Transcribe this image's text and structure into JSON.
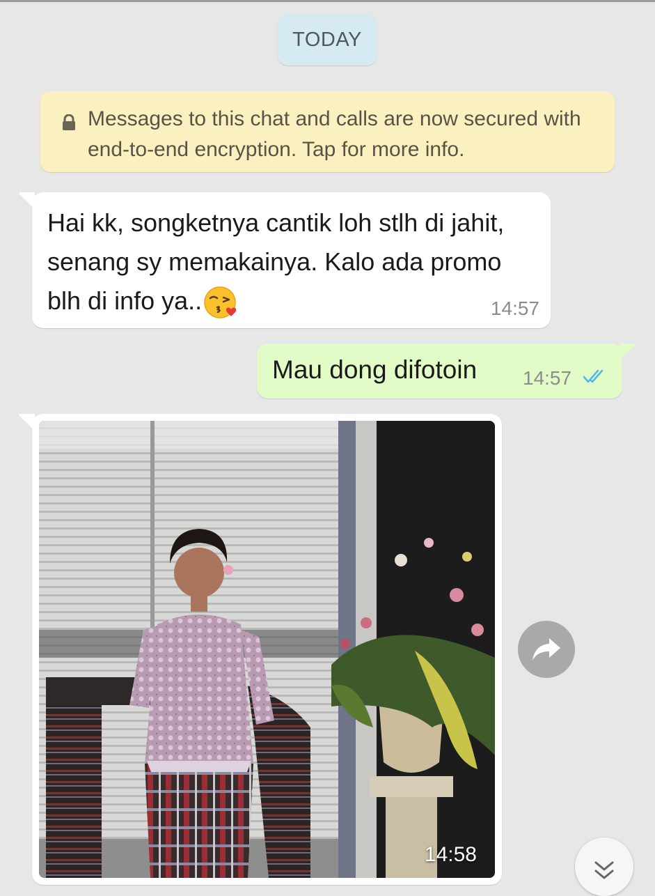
{
  "chat": {
    "date_label": "TODAY",
    "encryption_notice": "Messages to this chat and calls are now secured with end-to-end encryption. Tap for more info.",
    "messages": [
      {
        "direction": "incoming",
        "text": "Hai kk, songketnya cantik loh stlh di jahit, senang sy memakainya. Kalo ada promo blh di info ya..",
        "emoji": "kissing-face-with-heart",
        "time": "14:57"
      },
      {
        "direction": "outgoing",
        "text": "Mau dong difotoin",
        "time": "14:57",
        "status": "read"
      },
      {
        "direction": "incoming",
        "type": "image",
        "image_description": "woman in lilac lace kebaya holding a dark striped songket beside a vase of flowers",
        "time": "14:58"
      }
    ]
  },
  "colors": {
    "background": "#e7e7e7",
    "incoming_bubble": "#ffffff",
    "outgoing_bubble": "#e2fcc7",
    "encryption_notice": "#fbf0bf",
    "date_chip": "#d6eaf2",
    "read_ticks": "#4fb5ea"
  },
  "icons": {
    "lock": "lock-icon",
    "read_receipt": "double-check-icon",
    "forward": "share-arrow-icon",
    "scroll_down": "double-chevron-down-icon"
  }
}
